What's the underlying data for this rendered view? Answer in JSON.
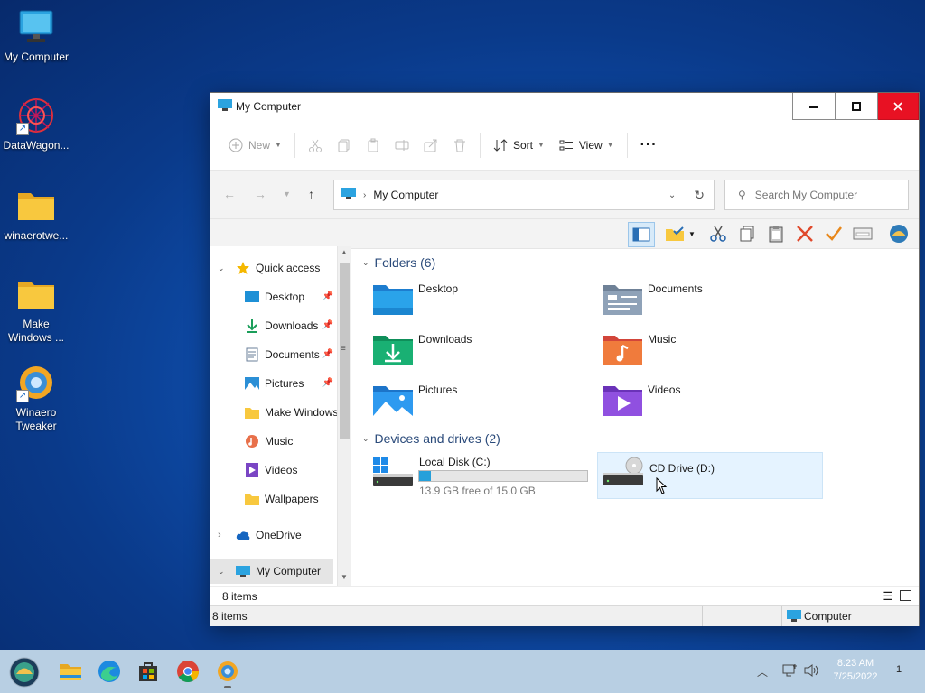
{
  "desktop": {
    "icons": [
      {
        "label": "My Computer"
      },
      {
        "label": "DataWagon..."
      },
      {
        "label": "winaerotwe..."
      },
      {
        "label": "Make Windows ..."
      },
      {
        "label": "Winaero Tweaker"
      }
    ]
  },
  "window": {
    "title": "My Computer",
    "controls": {
      "minimize": "minimize",
      "maximize": "maximize",
      "close": "close"
    }
  },
  "commandbar": {
    "new_label": "New",
    "sort_label": "Sort",
    "view_label": "View",
    "more_label": "···"
  },
  "address": {
    "path": "My Computer",
    "search_placeholder": "Search My Computer"
  },
  "navpane": {
    "quick_access": "Quick access",
    "items": [
      {
        "label": "Desktop",
        "pinned": true
      },
      {
        "label": "Downloads",
        "pinned": true
      },
      {
        "label": "Documents",
        "pinned": true
      },
      {
        "label": "Pictures",
        "pinned": true
      },
      {
        "label": "Make Windows",
        "pinned": false
      },
      {
        "label": "Music",
        "pinned": false
      },
      {
        "label": "Videos",
        "pinned": false
      },
      {
        "label": "Wallpapers",
        "pinned": false
      }
    ],
    "onedrive": "OneDrive",
    "mycomputer": "My Computer"
  },
  "content": {
    "folders_header": "Folders (6)",
    "folders": [
      {
        "label": "Desktop"
      },
      {
        "label": "Documents"
      },
      {
        "label": "Downloads"
      },
      {
        "label": "Music"
      },
      {
        "label": "Pictures"
      },
      {
        "label": "Videos"
      }
    ],
    "drives_header": "Devices and drives (2)",
    "drives": [
      {
        "label": "Local Disk (C:)",
        "free_text": "13.9 GB free of 15.0 GB",
        "used_fraction": 0.07
      },
      {
        "label": "CD Drive (D:)"
      }
    ]
  },
  "status": {
    "items_count": "8 items",
    "items_count_bottom": "8 items",
    "location": "Computer"
  },
  "taskbar": {
    "time": "8:23 AM",
    "date": "7/25/2022",
    "notification_count": "1"
  },
  "colors": {
    "accent": "#0078d4",
    "close_red": "#e81123",
    "selection": "#cce8ff",
    "folder_yellow": "#f8c83e"
  }
}
